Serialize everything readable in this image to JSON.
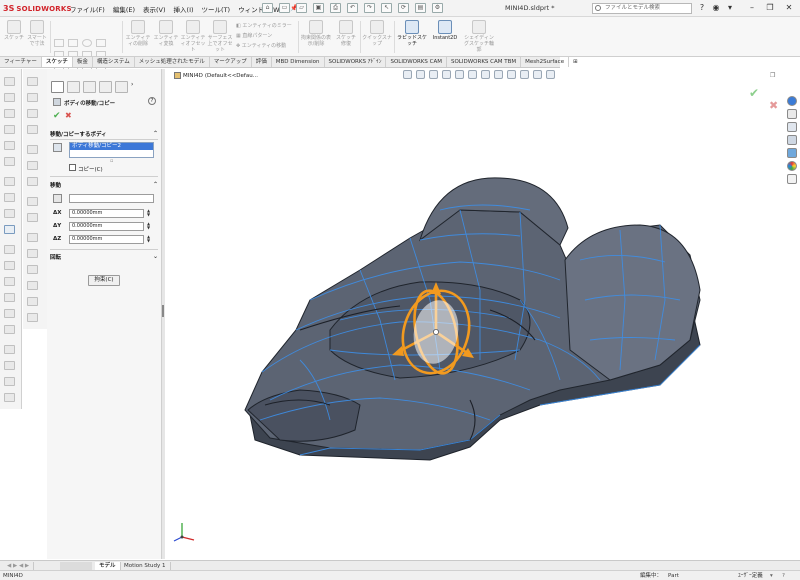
{
  "app": {
    "logo_ds": "3S",
    "logo_name": "SOLIDWORKS",
    "menus": [
      "ファイル(F)",
      "編集(E)",
      "表示(V)",
      "挿入(I)",
      "ツール(T)",
      "ウィンドウ(W)"
    ],
    "document_title": "MINI4D.sldprt *",
    "search_placeholder": "ファイルとモデル検索"
  },
  "ribbon": {
    "buttons": [
      {
        "label": "スケッチ",
        "active": false
      },
      {
        "label": "スマートで寸法",
        "active": false
      },
      {
        "label": "エンティティの削除",
        "active": false
      },
      {
        "label": "エンティティ変換",
        "active": false
      },
      {
        "label": "エンティティオフセット",
        "active": false
      },
      {
        "label": "サーフェス上でオフセット",
        "active": false
      },
      {
        "label": "エンティティのミラー",
        "active": false
      },
      {
        "label": "直線パターン",
        "active": false
      },
      {
        "label": "エンティティの移動",
        "active": false
      },
      {
        "label": "拘束関係の表示/削除",
        "active": false
      },
      {
        "label": "スケッチ修復",
        "active": false
      },
      {
        "label": "クイックスナップ",
        "active": false
      },
      {
        "label": "ラピッドスケッチ",
        "active": true
      },
      {
        "label": "Instant2D",
        "active": true
      },
      {
        "label": "シェイディングスケッチ輪郭",
        "active": false
      }
    ]
  },
  "tabs": [
    "フィーチャー",
    "スケッチ",
    "板金",
    "構造システム",
    "メッシュ処理されたモデル",
    "マークアップ",
    "評価",
    "MBD Dimension",
    "SOLIDWORKS ｱﾄﾞｲﾝ",
    "SOLIDWORKS CAM",
    "SOLIDWORKS CAM TBM",
    "Mesh2Surface"
  ],
  "active_tab_index": 1,
  "property_manager": {
    "title": "ボディの移動/コピー",
    "bodies_section": "移動/コピーするボディ",
    "selected_body": "ボディ移動/コピー2",
    "copy_label": "コピー(C)",
    "move_section": "移動",
    "dx_label": "ΔX",
    "dy_label": "ΔY",
    "dz_label": "ΔZ",
    "dx": "0.00000mm",
    "dy": "0.00000mm",
    "dz": "0.00000mm",
    "rotate_section": "回転",
    "constraints_button": "拘束(C)",
    "copy_checked": false
  },
  "viewport": {
    "tree_root": "MINI4D",
    "tree_config": "(Default<<Defau..."
  },
  "bottom_tabs": [
    "モデル",
    "Motion Study 1"
  ],
  "status": {
    "left": "MINI4D",
    "editing": "編集中：",
    "mode": "Part",
    "units": "ﾕｰｻﾞｰ定義"
  },
  "colors": {
    "model_body": "#5c6473",
    "model_highlight": "#3d8fe8",
    "triad": "#f29a1f",
    "accept": "#4caf50",
    "cancel": "#d9534f"
  }
}
